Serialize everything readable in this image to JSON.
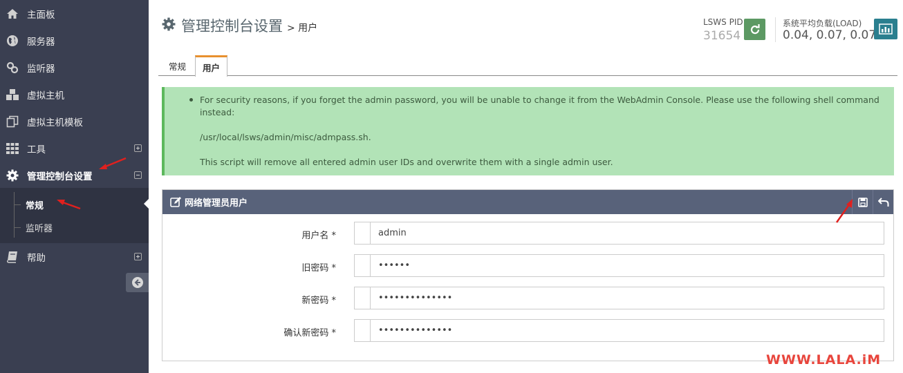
{
  "sidebar": {
    "items": [
      {
        "label": "主面板",
        "icon": "home-icon"
      },
      {
        "label": "服务器",
        "icon": "globe-icon"
      },
      {
        "label": "监听器",
        "icon": "link-icon"
      },
      {
        "label": "虚拟主机",
        "icon": "cubes-icon"
      },
      {
        "label": "虚拟主机模板",
        "icon": "copy-icon"
      },
      {
        "label": "工具",
        "icon": "grid-icon"
      },
      {
        "label": "管理控制台设置",
        "icon": "gear-icon"
      },
      {
        "label": "帮助",
        "icon": "book-icon"
      }
    ],
    "subitems": [
      {
        "label": "常规"
      },
      {
        "label": "监听器"
      }
    ]
  },
  "header": {
    "title": "管理控制台设置",
    "subtitle": "> 用户",
    "pid_label": "LSWS PID",
    "pid_value": "31654",
    "load_label": "系统平均负载(LOAD)",
    "load_value": "0.04, 0.07, 0.07"
  },
  "tabs": [
    {
      "label": "常规"
    },
    {
      "label": "用户"
    }
  ],
  "alert": {
    "line1": "For security reasons, if you forget the admin password, you will be unable to change it from the WebAdmin Console. Please use the following shell command",
    "line2": "instead:",
    "command": "/usr/local/lsws/admin/misc/admpass.sh.",
    "note": "This script will remove all entered admin user IDs and overwrite them with a single admin user."
  },
  "panel": {
    "title": "网络管理员用户",
    "fields": [
      {
        "label": "用户名 *",
        "value": "admin"
      },
      {
        "label": "旧密码 *",
        "value": "••••••"
      },
      {
        "label": "新密码 *",
        "value": "••••••••••••••"
      },
      {
        "label": "确认新密码 *",
        "value": "••••••••••••••"
      }
    ]
  },
  "watermark": "WWW.LALA.iM",
  "colors": {
    "sidebar_bg": "#3a3f51",
    "alert_bg": "#b2e3b7",
    "panel_head_bg": "#58627a",
    "active_tab_accent": "#e8902e",
    "reload_button": "#5c9963",
    "stats_button": "#2a7f8f",
    "annotation_arrow": "#e0201e"
  }
}
